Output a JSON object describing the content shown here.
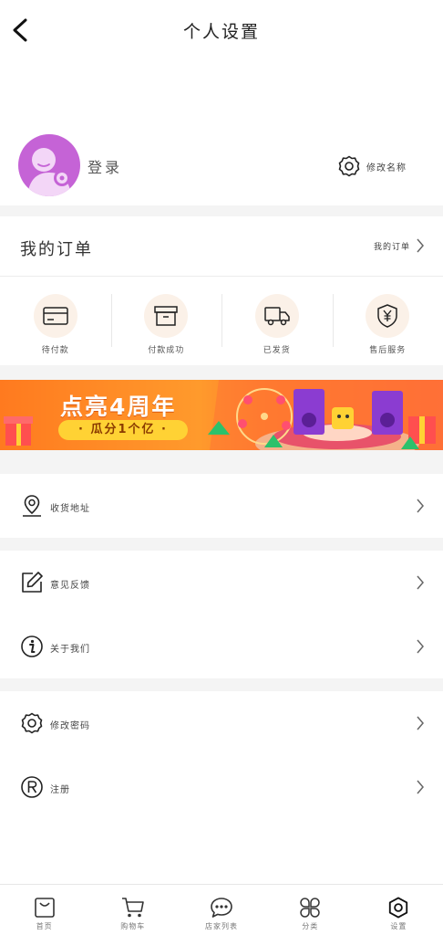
{
  "header": {
    "title": "个人设置",
    "back_icon": "chevron-left-icon"
  },
  "profile": {
    "login_label": "登录",
    "edit_name_label": "修改名称",
    "avatar_color": "#c563d6",
    "edit_icon": "gear-icon"
  },
  "orders": {
    "title": "我的订单",
    "more_label": "我的订单",
    "items": [
      {
        "label": "待付款",
        "icon": "card-icon"
      },
      {
        "label": "付款成功",
        "icon": "box-icon"
      },
      {
        "label": "已发货",
        "icon": "truck-icon"
      },
      {
        "label": "售后服务",
        "icon": "yuan-shield-icon"
      }
    ],
    "icon_bg": "#fbf1e8"
  },
  "banner": {
    "title": "点亮4周年",
    "subtitle": "· 瓜分1个亿 ·",
    "bg": "#ff8a24",
    "pill_color": "#ffd234"
  },
  "menu": {
    "address": {
      "label": "收货地址",
      "icon": "location-pin-icon"
    },
    "feedback": {
      "label": "意见反馈",
      "icon": "edit-icon"
    },
    "about": {
      "label": "关于我们",
      "icon": "info-icon"
    },
    "password": {
      "label": "修改密码",
      "icon": "gear-icon"
    },
    "register": {
      "label": "注册",
      "icon": "registered-icon"
    }
  },
  "tabbar": {
    "items": [
      {
        "label": "首页",
        "icon": "bag-icon"
      },
      {
        "label": "购物车",
        "icon": "cart-icon"
      },
      {
        "label": "店家列表",
        "icon": "chat-icon"
      },
      {
        "label": "分类",
        "icon": "grid-icon"
      },
      {
        "label": "设置",
        "icon": "gear-icon"
      }
    ]
  }
}
